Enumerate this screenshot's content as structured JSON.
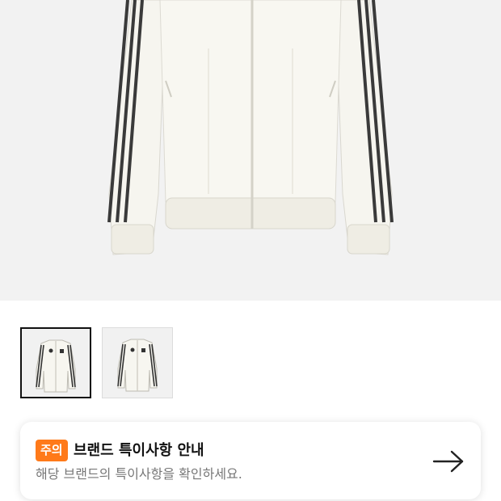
{
  "product": {
    "image_icon": "white-track-jacket-image"
  },
  "thumbnails": [
    {
      "icon": "jacket-thumbnail",
      "selected": true
    },
    {
      "icon": "jacket-thumbnail",
      "selected": false
    }
  ],
  "notice": {
    "badge": "주의",
    "title": "브랜드 특이사항 안내",
    "subtitle": "해당 브랜드의 특이사항을 확인하세요.",
    "arrow_icon": "arrow-right-icon",
    "badge_color": "#ff7a1a"
  }
}
